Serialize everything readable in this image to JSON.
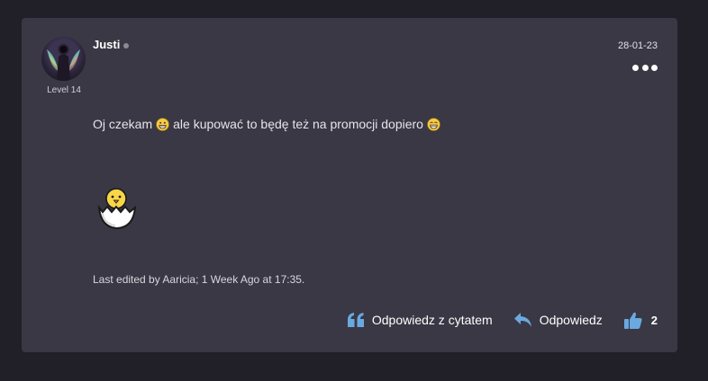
{
  "post": {
    "username": "Justi",
    "level": "Level 14",
    "date": "28-01-23",
    "message_part1": "Oj czekam",
    "message_part2": "ale kupować to będę też na promocji dopiero",
    "edited": "Last edited by Aaricia; 1 Week Ago at 17:35."
  },
  "actions": {
    "quote_reply": "Odpowiedz z cytatem",
    "reply": "Odpowiedz",
    "like_count": "2"
  },
  "icons": {
    "more": "more-dots-icon",
    "quote": "quote-icon",
    "reply": "reply-arrow-icon",
    "like": "thumbs-up-icon",
    "emoji1": "grinning-face-icon",
    "emoji2": "grinning-squinting-face-icon",
    "chick": "hatching-chick-icon"
  },
  "colors": {
    "background": "#212029",
    "card": "#393844",
    "accent": "#6aa9e0"
  }
}
